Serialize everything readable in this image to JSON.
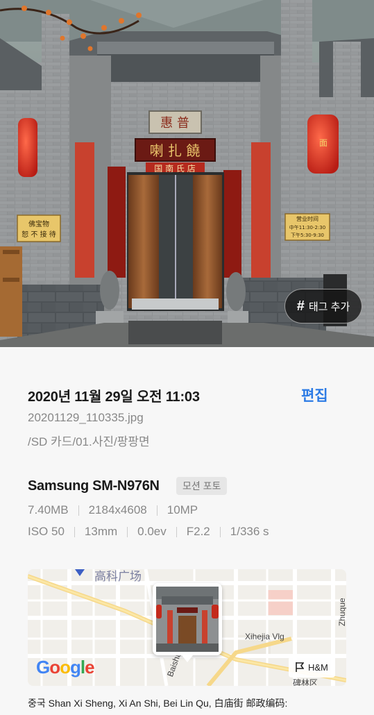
{
  "photo": {
    "tag_button_label": "태그 추가",
    "tag_button_icon": "hash-icon",
    "signs": {
      "top_plaque": "惠 普",
      "name_board": "喇 扎 饒",
      "name_subtitle": "国 南 氏 店",
      "left_notice": [
        "佛宝物",
        "恕 不 接 待"
      ],
      "right_notice": [
        "营业时间",
        "中午11:30-2:30",
        "下午5:30-9:30"
      ],
      "lantern_text": "面"
    }
  },
  "details": {
    "date": "2020년 11월 29일 오전 11:03",
    "edit_label": "편집",
    "filename": "20201129_110335.jpg",
    "path": "/SD 카드/01.사진/팡팡면",
    "device": "Samsung SM-N976N",
    "badge": "모션 포토",
    "specs_row1": [
      "7.40MB",
      "2184x4608",
      "10MP"
    ],
    "specs_row2": [
      "ISO 50",
      "13mm",
      "0.0ev",
      "F2.2",
      "1/336 s"
    ],
    "address": "중국 Shan Xi Sheng, Xi An Shi, Bei Lin Qu, 白庙街 邮政编码:"
  },
  "map": {
    "labels": {
      "top": "高科广场",
      "zhuque": "Zhuque Ave",
      "xihejia": "Xihejia Vlg",
      "baisha": "Baisha",
      "bottom_right": "碑林区"
    },
    "google": [
      "G",
      "o",
      "o",
      "g",
      "l",
      "e"
    ],
    "google_colors": [
      "#4285F4",
      "#EA4335",
      "#FBBC05",
      "#4285F4",
      "#34A853",
      "#EA4335"
    ],
    "hm_label": "H&M",
    "hm_icon": "store-flag-icon"
  },
  "colors": {
    "accent": "#2c7be5",
    "secondary_text": "#888888",
    "background": "#f7f7f7"
  }
}
